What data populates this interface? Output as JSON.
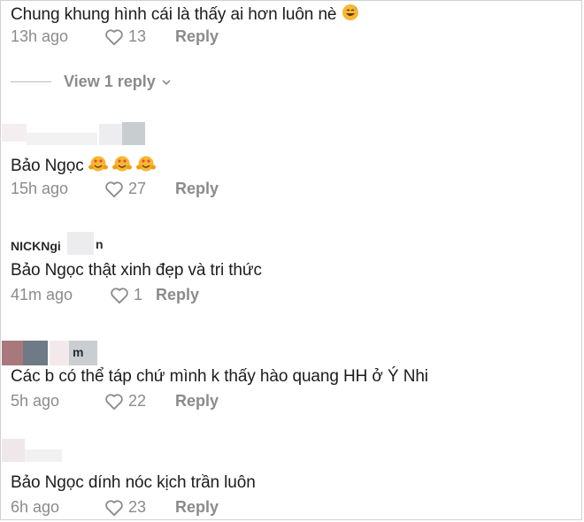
{
  "comments": [
    {
      "text": "Chung khung hình cái là thấy ai hơn luôn nè",
      "emoji": "grinning-sweat-emoji",
      "time": "13h ago",
      "likes": "13",
      "reply": "Reply"
    },
    {
      "text": "Bảo Ngọc",
      "emoji": "heart-eyes-hands-emoji x3",
      "time": "15h ago",
      "likes": "27",
      "reply": "Reply"
    },
    {
      "username": "NICKNgi",
      "username_tail": "n",
      "text": "Bảo Ngọc thật xinh đẹp và tri thức",
      "time": "41m ago",
      "likes": "1",
      "reply": "Reply"
    },
    {
      "username_tail": "m",
      "text": "Các b có thể táp chứ mình k thấy hào quang HH ở Ý Nhi",
      "time": "5h ago",
      "likes": "22",
      "reply": "Reply"
    },
    {
      "text": "Bảo Ngọc dính nóc kịch trần luôn",
      "time": "6h ago",
      "likes": "23",
      "reply": "Reply"
    }
  ],
  "view_replies": {
    "label": "View 1 reply"
  },
  "colors": {
    "text": "#1c1c1c",
    "meta": "#8b8b8b",
    "emoji": "#f5a623"
  }
}
